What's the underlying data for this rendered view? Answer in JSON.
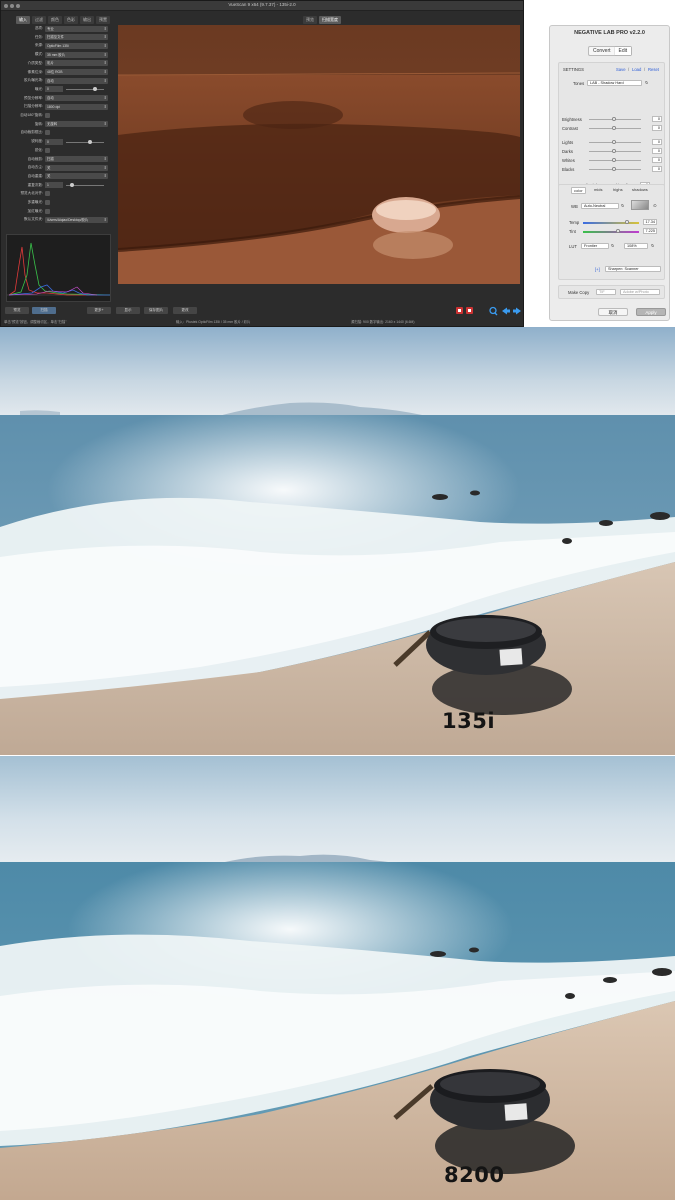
{
  "vuescan": {
    "title": "VueScan 9 x64 (9.7.37) - 135i-2.0",
    "tabs": [
      "输入",
      "过滤",
      "颜色",
      "色彩",
      "输出",
      "预置"
    ],
    "active_tab": 0,
    "settings": [
      {
        "label": "选项:",
        "type": "select",
        "value": "专业"
      },
      {
        "label": "任务:",
        "type": "select",
        "value": "扫描至文件"
      },
      {
        "label": "来源:",
        "type": "select",
        "value": "OpticFilm 135i"
      },
      {
        "label": "模式:",
        "type": "select",
        "value": "35 mm 胶片"
      },
      {
        "label": "介质类型:",
        "type": "select",
        "value": "彩片"
      },
      {
        "label": "像素位深:",
        "type": "select",
        "value": "48位 RGB"
      },
      {
        "label": "胶片曝光场:",
        "type": "select",
        "value": "自动"
      },
      {
        "label": "曝光:",
        "type": "slider",
        "value": "0",
        "level": 0.75
      },
      {
        "label": "预览分辨率:",
        "type": "select",
        "value": "自动"
      },
      {
        "label": "扫描分辨率:",
        "type": "select",
        "value": "1800 dpi"
      },
      {
        "label": "自动180°旋转:",
        "type": "check"
      },
      {
        "label": "旋转:",
        "type": "select",
        "value": "无旋转"
      },
      {
        "label": "自动裁剪框比:",
        "type": "check"
      },
      {
        "label": "锐利度:",
        "type": "slider",
        "value": "0",
        "level": 0.6
      },
      {
        "label": "锐化:",
        "type": "check"
      },
      {
        "label": "自动裁剪:",
        "type": "select",
        "value": "扫描"
      },
      {
        "label": "自动去尘:",
        "type": "select",
        "value": "关"
      },
      {
        "label": "自动重建:",
        "type": "select",
        "value": "关"
      },
      {
        "label": "重复次数:",
        "type": "slider",
        "value": "1",
        "level": 0.1
      },
      {
        "label": "预览大北对齐:",
        "type": "check"
      },
      {
        "label": "多重曝光:",
        "type": "check"
      },
      {
        "label": "加红曝光:",
        "type": "check"
      },
      {
        "label": "默认文件夹:",
        "type": "select",
        "value": "/Users/Aiqiao/Desktop/胶片"
      }
    ],
    "preview_tabs": [
      "预览",
      "扫描宽度"
    ],
    "active_preview_tab": 1,
    "bottom_buttons": [
      "预览",
      "扫描",
      "更多+",
      "显示",
      "保存图片",
      "更改"
    ],
    "status_left": "单击\"预览\"按钮，调整裁切区，单击\"扫描\"",
    "status_mid": "输入：Plustek OpticFilm 135i / 35 mm 胶片 / 彩片",
    "status_right": "源扫描: 900 数字输出: 2160 x 1440 (6.6M)"
  },
  "nlp": {
    "title": "NEGATIVE LAB PRO v2.2.0",
    "tabs": [
      "Convert",
      "Edit"
    ],
    "active_tab": 1,
    "settings_label": "SETTINGS",
    "settings_links": [
      "Save",
      "Load",
      "Reset"
    ],
    "tones_label": "Tones",
    "tones_value": "LAB - Shadow Hard",
    "sliders": [
      {
        "label": "Brightness",
        "value": "0",
        "level": 0.5
      },
      {
        "label": "Contrast",
        "value": "0",
        "level": 0.5
      },
      {
        "label": "Lights",
        "value": "0",
        "level": 0.5
      },
      {
        "label": "Darks",
        "value": "0",
        "level": 0.5
      },
      {
        "label": "Whites",
        "value": "0",
        "level": 0.5
      },
      {
        "label": "Blacks",
        "value": "0",
        "level": 0.5
      }
    ],
    "soft_highs": "Soft Highs",
    "soft_lows": "Soft Lows",
    "white_clip_label": "WhiteClip",
    "white_clip_value": "0",
    "black_clip_label": "BlackClip",
    "black_clip_value": "0",
    "color_tabs": [
      "color",
      "mids",
      "highs",
      "shadows"
    ],
    "active_color_tab": 0,
    "wb_label": "WB",
    "wb_value": "Auto-Neutral",
    "temp_label": "Temp",
    "temp_value": "17.34",
    "temp_level": 0.78,
    "tint_label": "Tint",
    "tint_value": "7.225",
    "tint_level": 0.62,
    "lut_label": "LUT",
    "lut_value": "Frontier",
    "lut_percent": "108%",
    "sharpen_toggle": "[+]",
    "sharpen_value": "Sharpen: Scanner",
    "make_copy_label": "Make Copy",
    "make_copy_a": "TIF",
    "make_copy_b": "Adobe w/Photo",
    "cancel_label": "取消",
    "apply_label": "Apply"
  },
  "photos": [
    {
      "label": "135i"
    },
    {
      "label": "8200"
    }
  ],
  "colors": {
    "accent": "#2a5bd7",
    "vuescan_bg": "#2c2c2c",
    "preview_orange": "#6b3a22"
  }
}
